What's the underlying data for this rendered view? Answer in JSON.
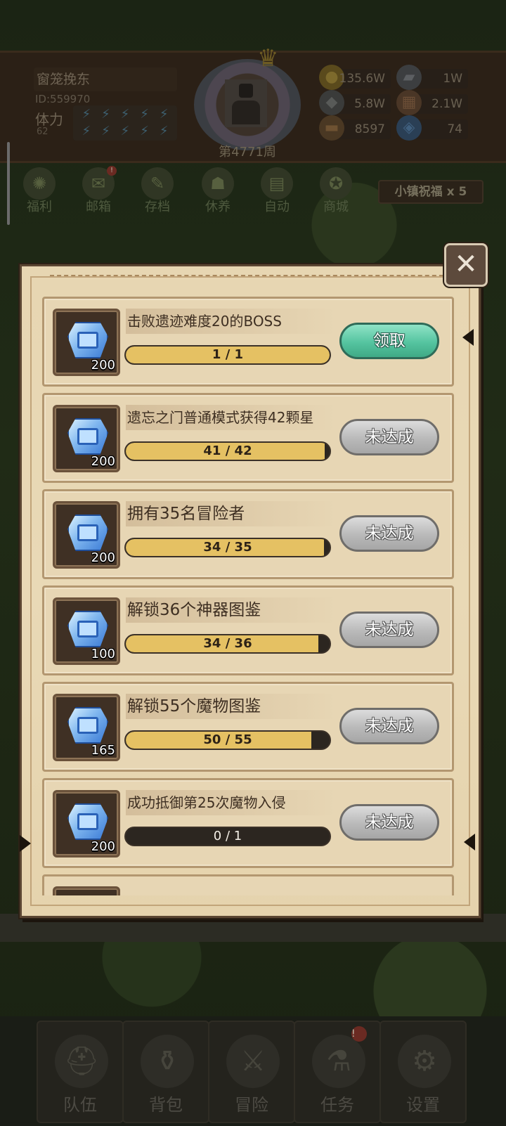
{
  "player": {
    "name": "窗笼挽东",
    "id_text": "ID:559970",
    "stamina_label": "体力",
    "stamina_value": "62",
    "stamina_icons": [
      "⚡",
      "⚡",
      "⚡",
      "⚡",
      "⚡",
      "⚡",
      "⚡",
      "⚡",
      "⚡",
      "⚡"
    ],
    "week": "第4771周"
  },
  "resources": [
    {
      "name": "gold-coin-icon",
      "value": "135.6W"
    },
    {
      "name": "steel-ingot-icon",
      "value": "1W"
    },
    {
      "name": "stone-ore-icon",
      "value": "5.8W"
    },
    {
      "name": "leather-icon",
      "value": "2.1W"
    },
    {
      "name": "wood-log-icon",
      "value": "8597"
    },
    {
      "name": "blue-gem-icon",
      "value": "74"
    }
  ],
  "menu": [
    {
      "label": "福利",
      "icon": "welfare-icon",
      "glyph": "✺",
      "badge": ""
    },
    {
      "label": "邮箱",
      "icon": "mailbox-icon",
      "glyph": "✉",
      "badge": "!"
    },
    {
      "label": "存档",
      "icon": "save-icon",
      "glyph": "✎",
      "badge": ""
    },
    {
      "label": "休养",
      "icon": "rest-icon",
      "glyph": "☗",
      "badge": ""
    },
    {
      "label": "自动",
      "icon": "auto-icon",
      "glyph": "▤",
      "badge": ""
    },
    {
      "label": "商城",
      "icon": "shop-icon",
      "glyph": "✪",
      "badge": ""
    }
  ],
  "blessing": "小镇祝福 x 5",
  "quests": [
    {
      "title": "击败遗迹难度20的BOSS",
      "reward": "200",
      "progress_text": "1 / 1",
      "progress": 1.0,
      "button": "领取",
      "state": "claim"
    },
    {
      "title": "遗忘之门普通模式获得42颗星",
      "reward": "200",
      "progress_text": "41 / 42",
      "progress": 0.976,
      "button": "未达成",
      "state": "locked"
    },
    {
      "title": "拥有35名冒险者",
      "reward": "200",
      "progress_text": "34 / 35",
      "progress": 0.971,
      "button": "未达成",
      "state": "locked"
    },
    {
      "title": "解锁36个神器图鉴",
      "reward": "100",
      "progress_text": "34 / 36",
      "progress": 0.944,
      "button": "未达成",
      "state": "locked"
    },
    {
      "title": "解锁55个魔物图鉴",
      "reward": "165",
      "progress_text": "50 / 55",
      "progress": 0.909,
      "button": "未达成",
      "state": "locked"
    },
    {
      "title": "成功抵御第25次魔物入侵",
      "reward": "200",
      "progress_text": "0 / 1",
      "progress": 0.0,
      "button": "未达成",
      "state": "locked"
    }
  ],
  "nav": [
    {
      "label": "队伍",
      "icon": "team-helmet-icon",
      "glyph": "⛑",
      "badge": ""
    },
    {
      "label": "背包",
      "icon": "backpack-icon",
      "glyph": "⚱",
      "badge": ""
    },
    {
      "label": "冒险",
      "icon": "crossed-swords-icon",
      "glyph": "⚔",
      "badge": ""
    },
    {
      "label": "任务",
      "icon": "quest-icon",
      "glyph": "⚗",
      "badge": "!"
    },
    {
      "label": "设置",
      "icon": "settings-gear-icon",
      "glyph": "⚙",
      "badge": ""
    }
  ],
  "colors": {
    "parchment": "#e7d6b2",
    "progress_fill": "#e5c163",
    "claim_button": "#55c4a0",
    "locked_button": "#b9b9b9"
  }
}
